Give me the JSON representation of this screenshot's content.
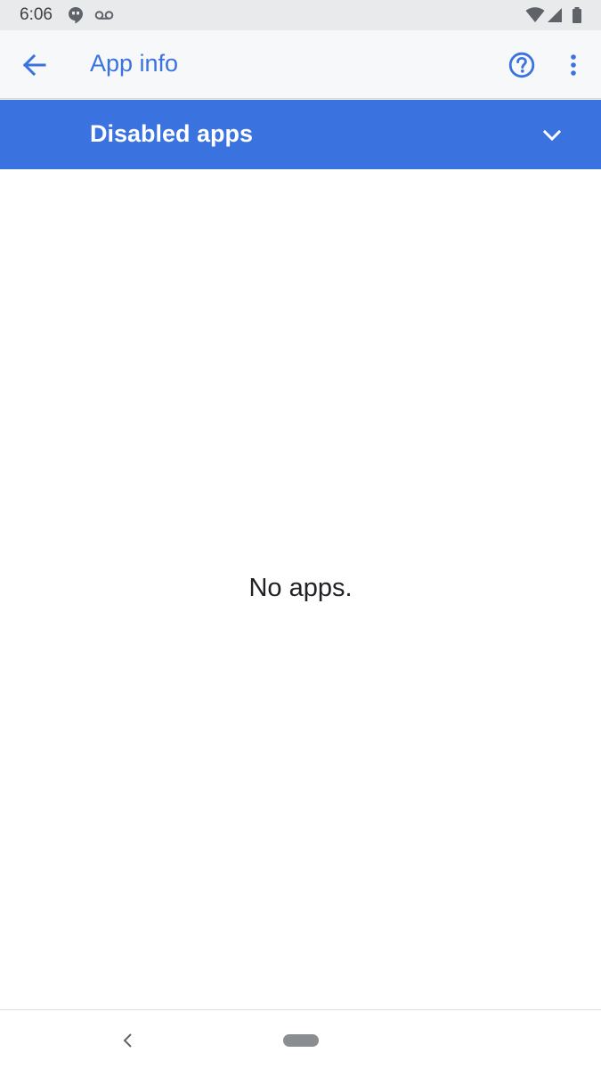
{
  "status_bar": {
    "time": "6:06",
    "icons": [
      "hangouts-notification-icon",
      "voicemail-icon",
      "wifi-icon",
      "signal-icon",
      "battery-icon"
    ]
  },
  "app_bar": {
    "title": "App info",
    "back_icon": "arrow-back-icon",
    "help_icon": "help-circle-icon",
    "more_icon": "more-vert-icon"
  },
  "filter": {
    "selected": "Disabled apps",
    "chevron_icon": "chevron-down-icon"
  },
  "content": {
    "empty_message": "No apps."
  },
  "nav_bar": {
    "back_icon": "nav-back-icon",
    "home_icon": "home-pill-icon"
  },
  "colors": {
    "accent": "#3a72e0",
    "status_bar_bg": "#e8eaec",
    "app_bar_bg": "#f7f8fa",
    "text_primary": "#202124"
  }
}
